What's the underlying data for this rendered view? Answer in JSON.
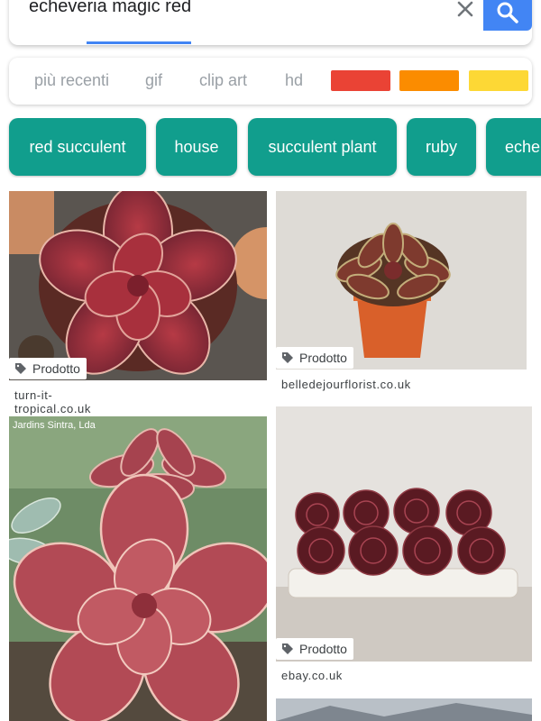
{
  "search": {
    "query": "echeveria magic red"
  },
  "filters": {
    "items": [
      "più recenti",
      "gif",
      "clip art",
      "hd"
    ],
    "colors": [
      "#ea4335",
      "#fb8c00",
      "#fdd835"
    ]
  },
  "chips": [
    "red succulent",
    "house",
    "succulent plant",
    "ruby",
    "eche"
  ],
  "results": [
    {
      "tag": "Prodotto",
      "source": "turn-it-tropical.co.uk"
    },
    {
      "tag": "Prodotto",
      "source": "belledejourflorist.co.uk"
    },
    {
      "watermark": "Jardins Sintra, Lda"
    },
    {
      "tag": "Prodotto",
      "source": "ebay.co.uk"
    }
  ],
  "colors": {
    "accent": "#4285f4",
    "chip": "#119e8d"
  }
}
